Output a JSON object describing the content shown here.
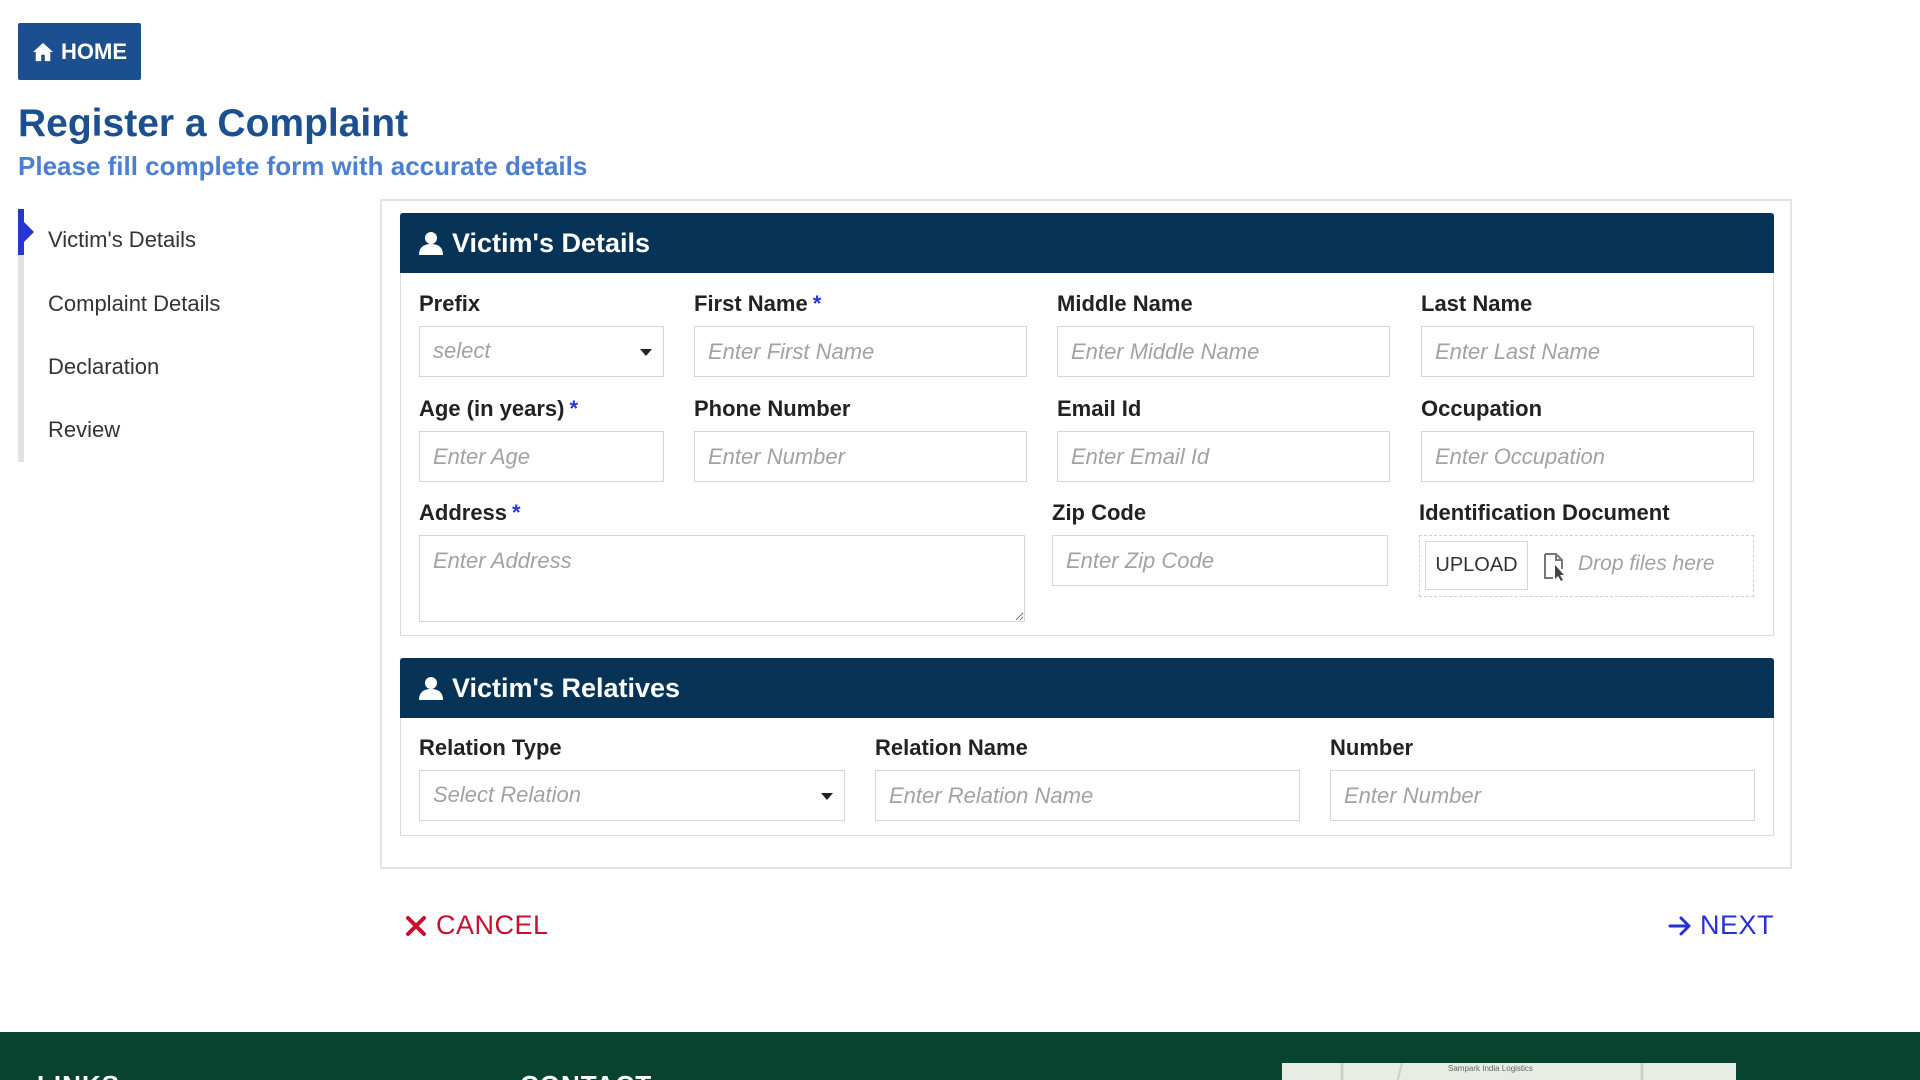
{
  "nav": {
    "home_label": "HOME"
  },
  "page": {
    "title": "Register a Complaint",
    "subtitle": "Please fill complete form with accurate details"
  },
  "steps": [
    {
      "label": "Victim's Details",
      "active": true
    },
    {
      "label": "Complaint Details",
      "active": false
    },
    {
      "label": "Declaration",
      "active": false
    },
    {
      "label": "Review",
      "active": false
    }
  ],
  "victim": {
    "header": "Victim's Details",
    "prefix": {
      "label": "Prefix",
      "value": "select"
    },
    "first_name": {
      "label": "First Name",
      "placeholder": "Enter First Name"
    },
    "middle_name": {
      "label": "Middle Name",
      "placeholder": "Enter Middle Name"
    },
    "last_name": {
      "label": "Last Name",
      "placeholder": "Enter Last Name"
    },
    "age": {
      "label": "Age (in years)",
      "placeholder": "Enter Age"
    },
    "phone": {
      "label": "Phone Number",
      "placeholder": "Enter Number"
    },
    "email": {
      "label": "Email Id",
      "placeholder": "Enter Email Id"
    },
    "occupation": {
      "label": "Occupation",
      "placeholder": "Enter Occupation"
    },
    "address": {
      "label": "Address",
      "placeholder": "Enter Address"
    },
    "zip": {
      "label": "Zip Code",
      "placeholder": "Enter Zip Code"
    },
    "id_doc": {
      "label": "Identification Document",
      "upload_label": "UPLOAD",
      "drop_text": "Drop files here"
    },
    "required_mark": "*"
  },
  "relatives": {
    "header": "Victim's Relatives",
    "relation_type": {
      "label": "Relation Type",
      "value": "Select Relation"
    },
    "relation_name": {
      "label": "Relation Name",
      "placeholder": "Enter Relation Name"
    },
    "number": {
      "label": "Number",
      "placeholder": "Enter Number"
    }
  },
  "actions": {
    "cancel_label": "CANCEL",
    "next_label": "NEXT"
  },
  "footer": {
    "links_heading": "LINKS",
    "contact_heading": "CONTACT",
    "map_caption": "Sampark India Logistics"
  },
  "colors": {
    "brand_blue": "#1b4f8f",
    "subtitle_blue": "#4a7fd4",
    "header_navy": "#063356",
    "required_blue": "#2437d6",
    "cancel_red": "#c8102e",
    "next_blue": "#2431d3",
    "footer_green": "#07432e"
  },
  "icons": {
    "home": "home-icon",
    "user": "user-icon",
    "caret": "caret-down-icon",
    "file": "file-drop-icon",
    "cancel": "close-icon",
    "next": "arrow-right-icon"
  }
}
